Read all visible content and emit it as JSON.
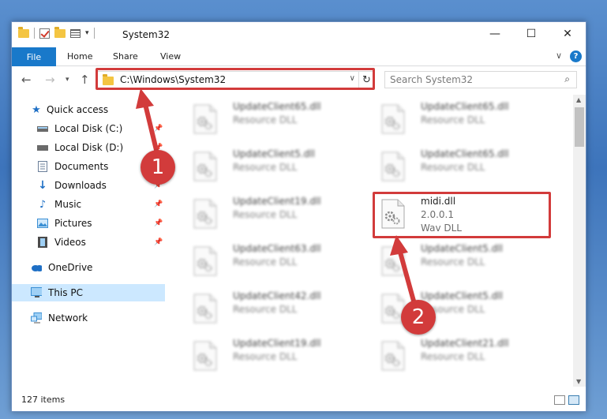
{
  "window": {
    "title": "System32",
    "controls": {
      "minimize": "—",
      "maximize": "☐",
      "close": "✕"
    }
  },
  "ribbon": {
    "file": "File",
    "tabs": [
      "Home",
      "Share",
      "View"
    ],
    "help": "?"
  },
  "address": {
    "path": "C:\\Windows\\System32",
    "search_placeholder": "Search System32"
  },
  "nav_pane": [
    {
      "label": "Quick access",
      "icon": "star-icon",
      "color": "#1e6fc5",
      "pinned": false
    },
    {
      "label": "Local Disk (C:)",
      "icon": "drive-icon",
      "color": "#5b5b5b",
      "pinned": true
    },
    {
      "label": "Local Disk (D:)",
      "icon": "drive-icon",
      "color": "#5b5b5b",
      "pinned": true
    },
    {
      "label": "Documents",
      "icon": "documents-icon",
      "color": "#6b7f9a",
      "pinned": true
    },
    {
      "label": "Downloads",
      "icon": "download-icon",
      "color": "#1e6fc5",
      "pinned": true
    },
    {
      "label": "Music",
      "icon": "music-icon",
      "color": "#1e6fc5",
      "pinned": true
    },
    {
      "label": "Pictures",
      "icon": "pictures-icon",
      "color": "#3a8fd4",
      "pinned": true
    },
    {
      "label": "Videos",
      "icon": "videos-icon",
      "color": "#4a4a4a",
      "pinned": true
    },
    {
      "label": "OneDrive",
      "icon": "cloud-icon",
      "color": "#1e6fc5",
      "pinned": false
    },
    {
      "label": "This PC",
      "icon": "computer-icon",
      "color": "#3a8fd4",
      "pinned": false,
      "selected": true
    },
    {
      "label": "Network",
      "icon": "network-icon",
      "color": "#3a8fd4",
      "pinned": false
    }
  ],
  "files": [
    {
      "name": "UpdateClient65.dll",
      "desc": "Resource DLL",
      "blurred": true
    },
    {
      "name": "UpdateClient65.dll",
      "desc": "Resource DLL",
      "blurred": true
    },
    {
      "name": "UpdateClient5.dll",
      "desc": "Resource DLL",
      "blurred": true
    },
    {
      "name": "UpdateClient65.dll",
      "desc": "Resource DLL",
      "blurred": true
    },
    {
      "name": "UpdateClient19.dll",
      "desc": "Resource DLL",
      "blurred": true
    },
    {
      "name": "midi.dll",
      "version": "2.0.0.1",
      "desc": "Wav DLL",
      "blurred": false,
      "highlighted": true
    },
    {
      "name": "UpdateClient63.dll",
      "desc": "Resource DLL",
      "blurred": true
    },
    {
      "name": "UpdateClient5.dll",
      "desc": "Resource DLL",
      "blurred": true
    },
    {
      "name": "UpdateClient42.dll",
      "desc": "Resource DLL",
      "blurred": true
    },
    {
      "name": "UpdateClient5.dll",
      "desc": "Resource DLL",
      "blurred": true
    },
    {
      "name": "UpdateClient19.dll",
      "desc": "Resource DLL",
      "blurred": true
    },
    {
      "name": "UpdateClient21.dll",
      "desc": "Resource DLL",
      "blurred": true
    }
  ],
  "status": {
    "item_count": "127 items"
  },
  "annotations": {
    "step1": "1",
    "step2": "2",
    "color": "#d23b3b"
  }
}
